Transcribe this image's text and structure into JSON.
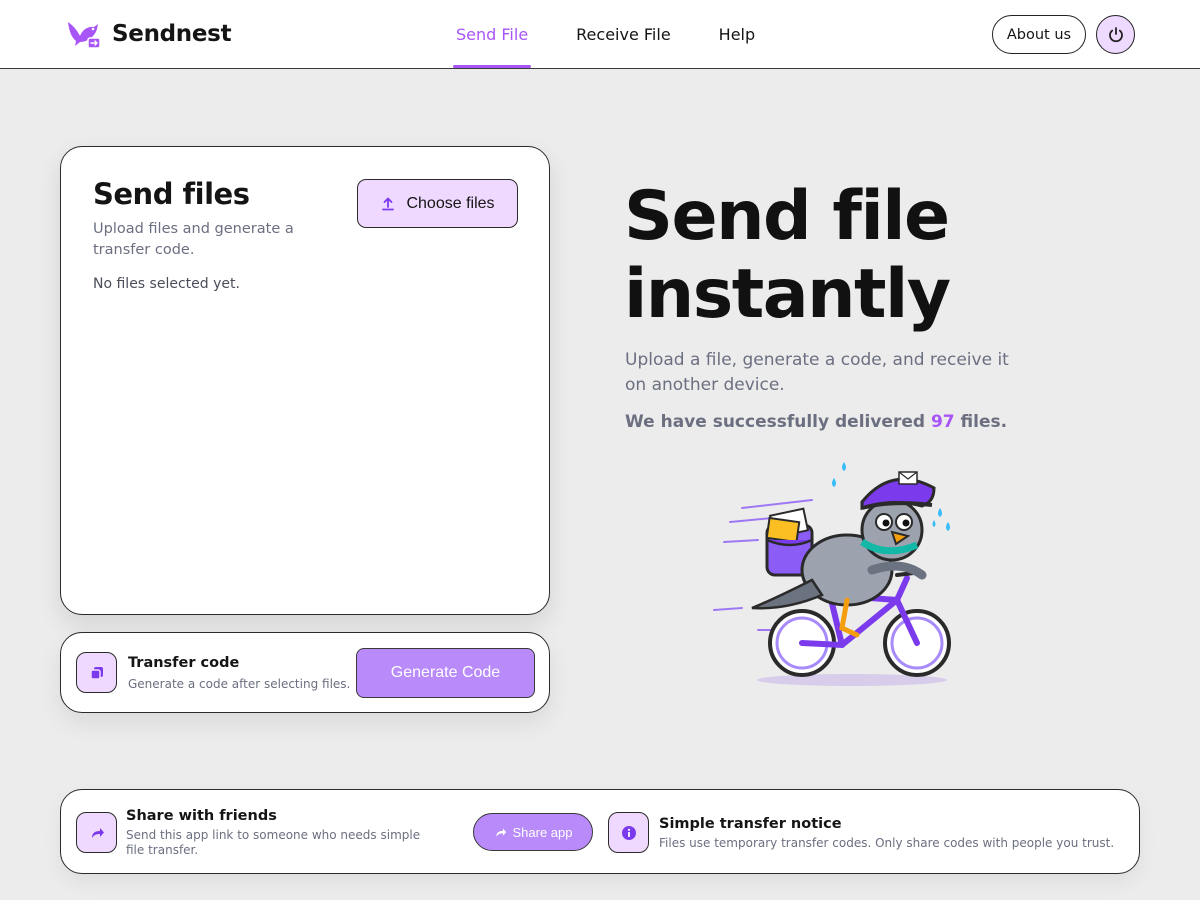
{
  "brand": {
    "name": "Sendnest",
    "logo_icon": "bird-logo-icon",
    "accent": "#a855f7"
  },
  "nav": {
    "items": [
      {
        "label": "Send File",
        "active": true
      },
      {
        "label": "Receive File",
        "active": false
      },
      {
        "label": "Help",
        "active": false
      }
    ]
  },
  "header": {
    "about_label": "About us",
    "power_icon": "power-icon"
  },
  "send_card": {
    "title": "Send files",
    "subtitle": "Upload files and generate a transfer code.",
    "empty_state": "No files selected yet.",
    "choose_label": "Choose files",
    "choose_icon": "upload-icon"
  },
  "code_card": {
    "title": "Transfer code",
    "subtitle": "Generate a code after selecting files.",
    "button_label": "Generate Code",
    "icon": "copy-icon"
  },
  "hero": {
    "title": "Send file instantly",
    "subtitle": "Upload a file, generate a code, and receive it on another device.",
    "stat_prefix": "We have successfully delivered ",
    "stat_count": "97",
    "stat_suffix": " files.",
    "illustration": "pigeon-courier-on-bicycle"
  },
  "footer": {
    "share_title": "Share with friends",
    "share_subtitle": "Send this app link to someone who needs simple file transfer.",
    "share_button": "Share app",
    "share_icon": "share-arrow-icon",
    "notice_title": "Simple transfer notice",
    "notice_subtitle": "Files use temporary transfer codes. Only share codes with people you trust.",
    "notice_icon": "info-icon"
  },
  "colors": {
    "accent": "#a855f7",
    "tile": "#efd9ff",
    "button": "#b98af9",
    "background": "#ececec"
  }
}
